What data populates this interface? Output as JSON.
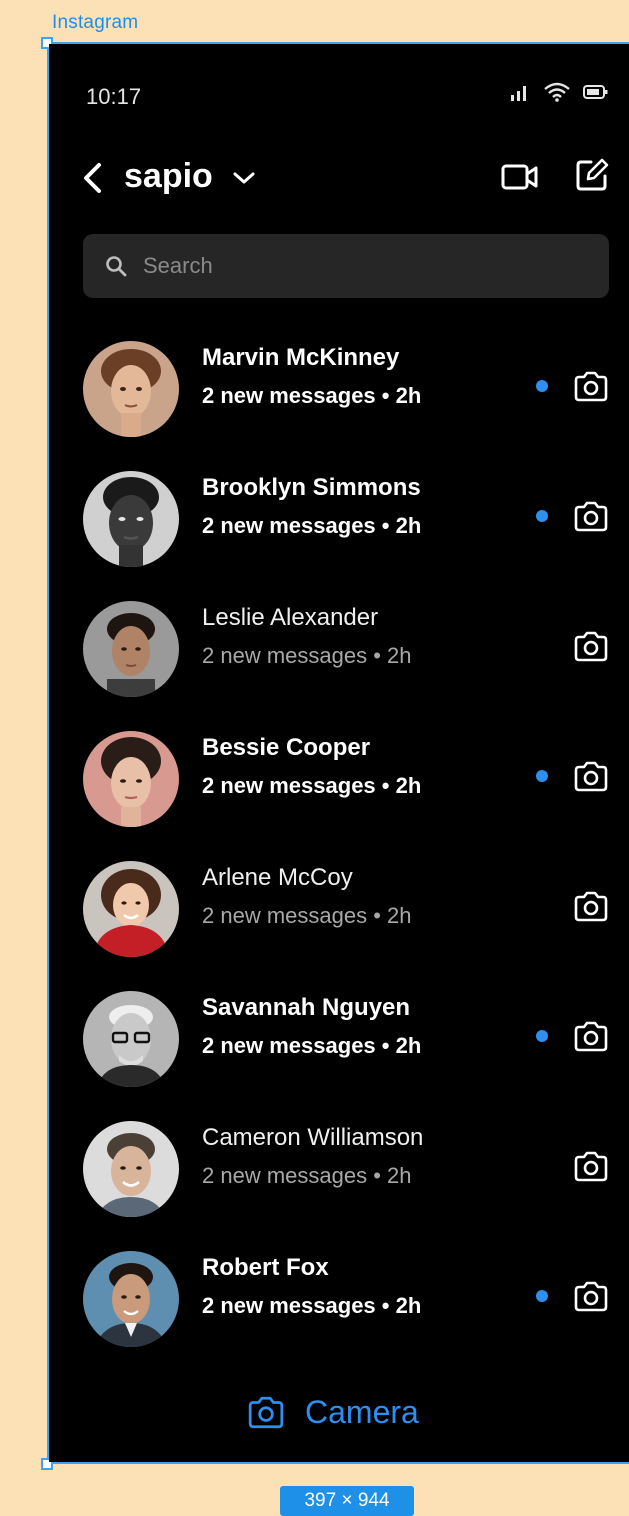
{
  "frame": {
    "label": "Instagram",
    "size_label": "397 × 944"
  },
  "status_bar": {
    "time": "10:17"
  },
  "header": {
    "account_name": "sapio"
  },
  "search": {
    "placeholder": "Search"
  },
  "conversations": [
    {
      "name": "Marvin McKinney",
      "meta": "2 new messages • 2h",
      "unread": true
    },
    {
      "name": "Brooklyn Simmons",
      "meta": "2 new messages • 2h",
      "unread": true
    },
    {
      "name": "Leslie Alexander",
      "meta": "2 new messages • 2h",
      "unread": false
    },
    {
      "name": "Bessie Cooper",
      "meta": "2 new messages • 2h",
      "unread": true
    },
    {
      "name": "Arlene McCoy",
      "meta": "2 new messages • 2h",
      "unread": false
    },
    {
      "name": "Savannah Nguyen",
      "meta": "2 new messages • 2h",
      "unread": true
    },
    {
      "name": "Cameron Williamson",
      "meta": "2 new messages • 2h",
      "unread": false
    },
    {
      "name": "Robert Fox",
      "meta": "2 new messages • 2h",
      "unread": true
    }
  ],
  "bottom_bar": {
    "camera_label": "Camera"
  },
  "colors": {
    "background": "#000000",
    "accent": "#2d8ff0",
    "search_bg": "#262626",
    "canvas": "#fde1b6"
  }
}
